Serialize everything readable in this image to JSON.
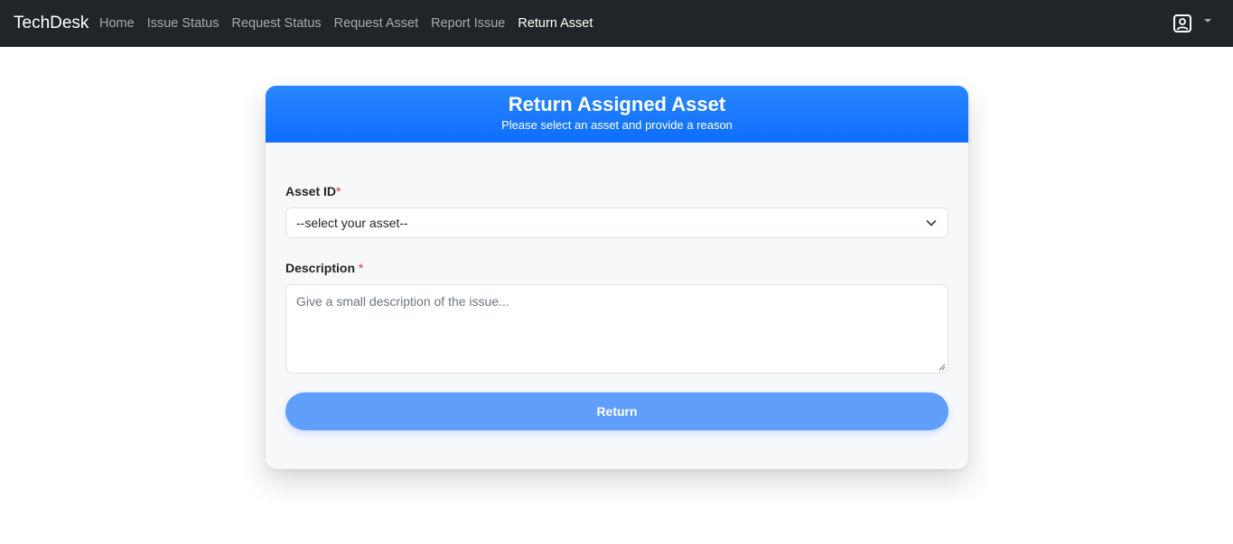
{
  "navbar": {
    "brand": "TechDesk",
    "links": [
      {
        "label": "Home",
        "active": false
      },
      {
        "label": "Issue Status",
        "active": false
      },
      {
        "label": "Request Status",
        "active": false
      },
      {
        "label": "Request Asset",
        "active": false
      },
      {
        "label": "Report Issue",
        "active": false
      },
      {
        "label": "Return Asset",
        "active": true
      }
    ],
    "user_icon": "user-square-icon",
    "dropdown_icon": "caret-down-icon"
  },
  "form": {
    "title": "Return Assigned Asset",
    "subtitle": "Please select an asset and provide a reason",
    "asset_label": "Asset ID",
    "required_mark": "*",
    "asset_select_value": "--select your asset--",
    "description_label": "Description",
    "description_placeholder": "Give a small description of the issue...",
    "submit_label": "Return"
  },
  "colors": {
    "navbar_bg": "#212529",
    "header_accent": "#0d6efd",
    "button": "#5f9ffb",
    "required": "#dc3545"
  }
}
